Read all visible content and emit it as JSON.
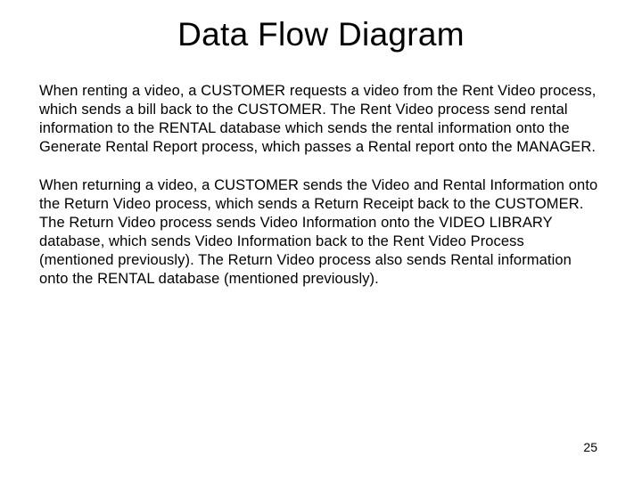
{
  "title": "Data Flow Diagram",
  "paragraph1": "When renting a video, a CUSTOMER requests a video from the Rent Video process, which sends a bill back to the CUSTOMER. The Rent Video process send rental information to the RENTAL database which sends the rental information onto the Generate Rental Report process, which passes a Rental report onto the MANAGER.",
  "paragraph2": "When returning a video, a CUSTOMER sends the Video and Rental Information onto the Return Video process, which sends a Return Receipt back to the CUSTOMER. The Return Video process sends Video Information onto the VIDEO LIBRARY database, which sends Video Information back to the Rent Video Process (mentioned previously). The Return Video process also sends Rental information onto the RENTAL database (mentioned previously).",
  "pageNumber": "25"
}
